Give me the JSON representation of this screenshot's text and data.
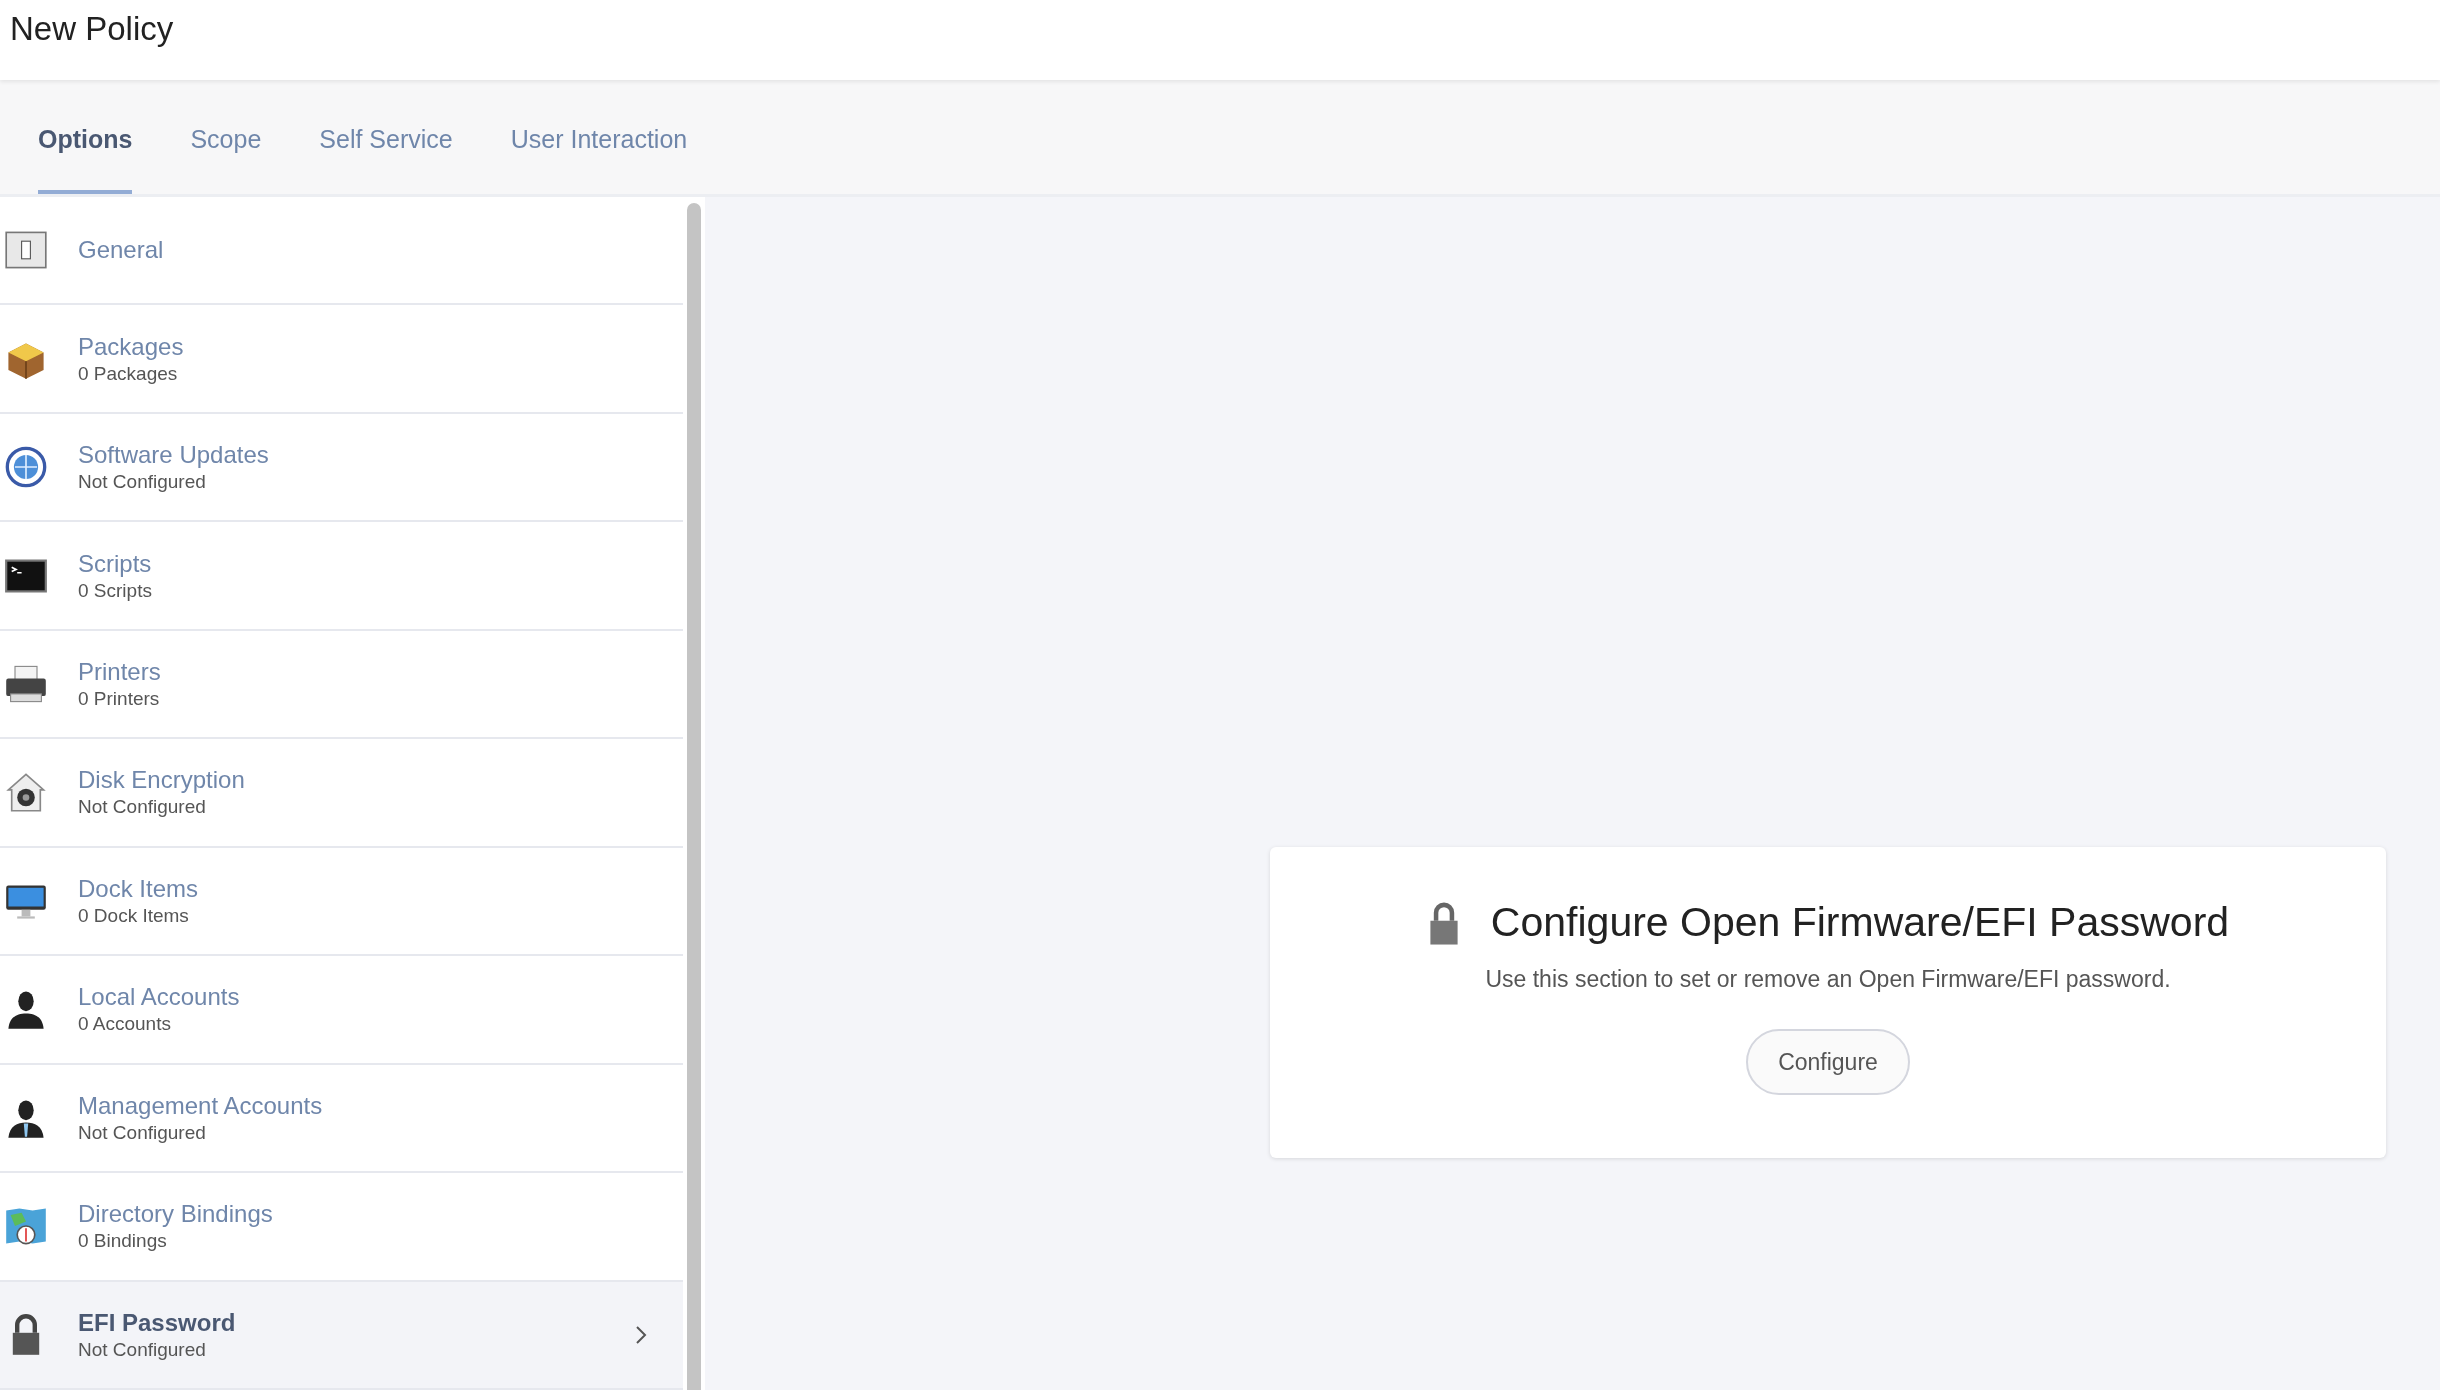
{
  "header": {
    "title": "New Policy"
  },
  "tabs": [
    {
      "label": "Options",
      "selected": true
    },
    {
      "label": "Scope",
      "selected": false
    },
    {
      "label": "Self Service",
      "selected": false
    },
    {
      "label": "User Interaction",
      "selected": false
    }
  ],
  "sidebar": {
    "items": [
      {
        "title": "General",
        "selected": false
      },
      {
        "title": "Packages",
        "subtitle": "0 Packages",
        "selected": false
      },
      {
        "title": "Software Updates",
        "subtitle": "Not Configured",
        "selected": false
      },
      {
        "title": "Scripts",
        "subtitle": "0 Scripts",
        "selected": false
      },
      {
        "title": "Printers",
        "subtitle": "0 Printers",
        "selected": false
      },
      {
        "title": "Disk Encryption",
        "subtitle": "Not Configured",
        "selected": false
      },
      {
        "title": "Dock Items",
        "subtitle": "0 Dock Items",
        "selected": false
      },
      {
        "title": "Local Accounts",
        "subtitle": "0 Accounts",
        "selected": false
      },
      {
        "title": "Management Accounts",
        "subtitle": "Not Configured",
        "selected": false
      },
      {
        "title": "Directory Bindings",
        "subtitle": "0 Bindings",
        "selected": false
      },
      {
        "title": "EFI Password",
        "subtitle": "Not Configured",
        "selected": true
      }
    ]
  },
  "panel": {
    "title": "Configure Open Firmware/EFI Password",
    "description": "Use this section to set or remove an Open Firmware/EFI password.",
    "button": "Configure"
  }
}
